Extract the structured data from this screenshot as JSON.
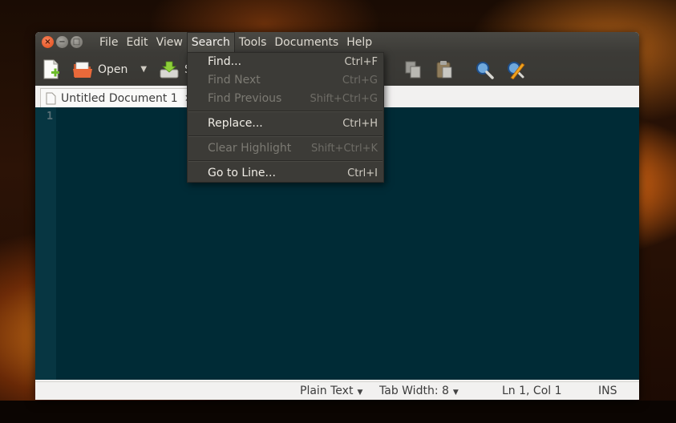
{
  "window": {
    "menus": [
      "File",
      "Edit",
      "View",
      "Search",
      "Tools",
      "Documents",
      "Help"
    ],
    "active_menu": "Search"
  },
  "toolbar": {
    "new_icon": "new-document-icon",
    "open_label": "Open",
    "open_icon": "folder-open-icon",
    "save_label": "S",
    "save_icon": "save-icon"
  },
  "tabs": [
    {
      "label": "Untitled Document 1"
    }
  ],
  "editor": {
    "line_numbers": [
      "1"
    ],
    "background": "#002b36",
    "gutter_background": "#073642"
  },
  "statusbar": {
    "language": "Plain Text",
    "tab_width": "Tab Width: 8",
    "position": "Ln 1, Col 1",
    "mode": "INS"
  },
  "search_menu": {
    "items": [
      {
        "label": "Find...",
        "accel": "Ctrl+F",
        "enabled": true
      },
      {
        "label": "Find Next",
        "accel": "Ctrl+G",
        "enabled": false
      },
      {
        "label": "Find Previous",
        "accel": "Shift+Ctrl+G",
        "enabled": false
      },
      {
        "label": "Replace...",
        "accel": "Ctrl+H",
        "enabled": true
      },
      {
        "label": "Clear Highlight",
        "accel": "Shift+Ctrl+K",
        "enabled": false
      },
      {
        "label": "Go to Line...",
        "accel": "Ctrl+I",
        "enabled": true
      }
    ]
  }
}
